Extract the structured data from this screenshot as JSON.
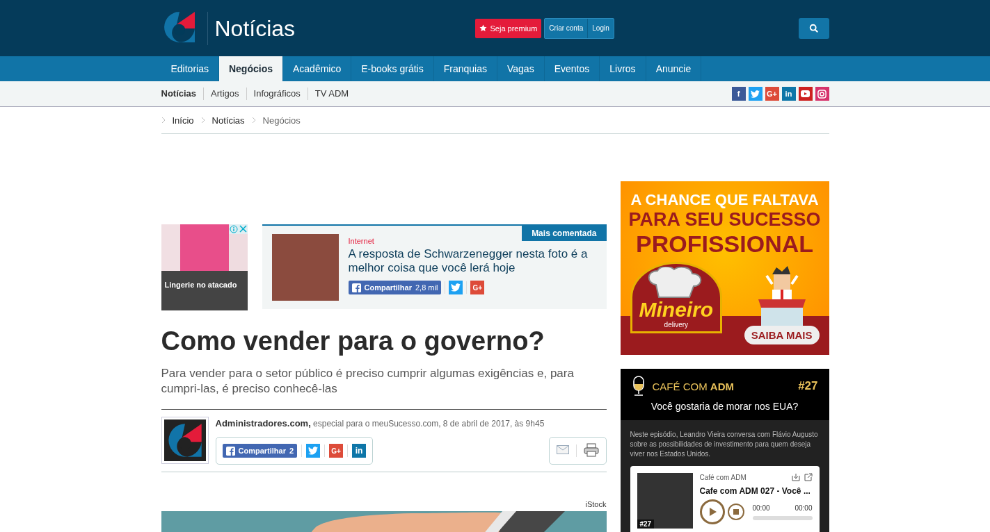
{
  "header": {
    "site_title": "Notícias",
    "premium_button": "Seja premium",
    "account_buttons": [
      "Criar conta",
      "Login"
    ]
  },
  "nav": {
    "items": [
      {
        "label": "Editorias",
        "selected": false
      },
      {
        "label": "Negócios",
        "selected": true
      },
      {
        "label": "Acadêmico",
        "selected": false
      },
      {
        "label": "E-books grátis",
        "selected": false
      },
      {
        "label": "Franquias",
        "selected": false
      },
      {
        "label": "Vagas",
        "selected": false
      },
      {
        "label": "Eventos",
        "selected": false
      },
      {
        "label": "Livros",
        "selected": false
      },
      {
        "label": "Anuncie",
        "selected": false
      }
    ]
  },
  "subnav": {
    "items": [
      {
        "label": "Notícias",
        "selected": true
      },
      {
        "label": "Artigos",
        "selected": false
      },
      {
        "label": "Infográficos",
        "selected": false
      },
      {
        "label": "TV ADM",
        "selected": false
      }
    ],
    "social": [
      {
        "kind": "facebook",
        "glyph": "f",
        "color": "#3b5998"
      },
      {
        "kind": "twitter",
        "color": "#1da1f2"
      },
      {
        "kind": "gplus",
        "glyph": "G+",
        "color": "#dd4b39"
      },
      {
        "kind": "linkedin",
        "glyph": "in",
        "color": "#0e76a8"
      },
      {
        "kind": "youtube",
        "color": "#cd201f"
      },
      {
        "kind": "instagram",
        "color": "#d6336c"
      }
    ]
  },
  "breadcrumb": [
    "Início",
    "Notícias",
    "Negócios"
  ],
  "ad_small": {
    "caption": "Lingerie no atacado"
  },
  "most_commented": {
    "badge": "Mais comentada",
    "category": "Internet",
    "headline": "A resposta de Schwarzenegger nesta foto é a melhor coisa que você lerá hoje",
    "share_label": "Compartilhar",
    "share_count": "2,8 mil",
    "gplus_glyph": "G+"
  },
  "article": {
    "title": "Como vender para o governo?",
    "subtitle": "Para vender para o setor público é preciso cumprir algumas exigências e, para cumpri-las, é preciso conhecê-las",
    "author": "Administradores.com,",
    "byline": "especial para o meuSucesso.com, 8 de abril de 2017, às 9h45",
    "share_label": "Compartilhar",
    "share_count": "2",
    "gplus_glyph": "G+",
    "linkedin_glyph": "in",
    "image_credit": "iStock"
  },
  "banner_ad": {
    "line_1": "A CHANCE QUE FALTAVA",
    "line_2": "PARA SEU SUCESSO",
    "line_3": "PROFISSIONAL",
    "brand": "Mineiro",
    "brand_sub": "delivery",
    "cta": "SAIBA MAIS"
  },
  "podcast": {
    "show_prefix": "CAFÉ COM",
    "show_bold": "ADM",
    "number": "#27",
    "question": "Você gostaria de morar nos EUA?",
    "description": "Neste episódio, Leandro Vieira conversa com Flávio Augusto sobre as possibilidades de investimento para quem deseja viver nos Estados Unidos.",
    "player": {
      "channel": "Café com ADM",
      "episode": "Cafe com ADM 027 - Você ...",
      "cover_number": "#27",
      "time_elapsed": "00:00",
      "time_total": "00:00"
    }
  }
}
